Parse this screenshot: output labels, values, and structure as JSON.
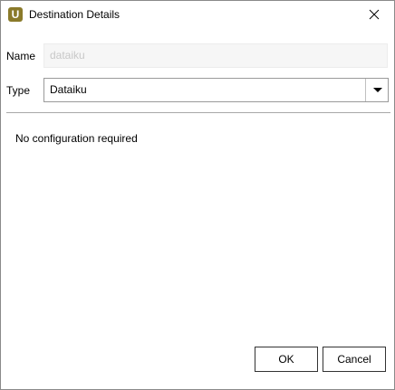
{
  "window": {
    "title": "Destination Details",
    "icon": "app-logo-icon",
    "icon_letter": "U",
    "accent_color": "#8a7a2a"
  },
  "form": {
    "name_label": "Name",
    "name_value": "dataiku",
    "type_label": "Type",
    "type_value": "Dataiku"
  },
  "body": {
    "message": "No configuration required"
  },
  "buttons": {
    "ok_label": "OK",
    "cancel_label": "Cancel"
  }
}
